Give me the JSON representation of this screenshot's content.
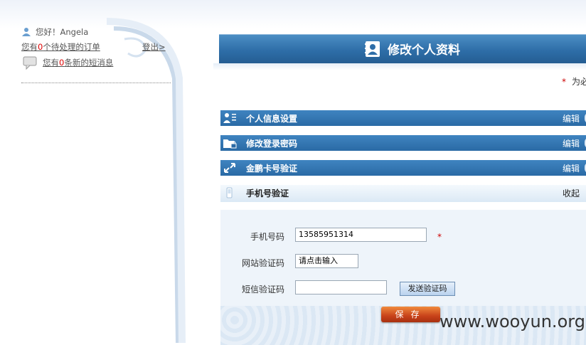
{
  "sidebar": {
    "greeting": "您好！Angela",
    "orders_prefix": "您有",
    "orders_count": "0",
    "orders_suffix": "个待处理的订单",
    "logout": "登出>",
    "msgs_prefix": "您有",
    "msgs_count": "0",
    "msgs_suffix": "条新的短消息"
  },
  "header": {
    "title": "修改个人资料",
    "required_note": "为必"
  },
  "sections": [
    {
      "label": "个人信息设置",
      "action": "编辑",
      "icon": "user-list-icon"
    },
    {
      "label": "修改登录密码",
      "action": "编辑",
      "icon": "folder-lock-icon"
    },
    {
      "label": "金鹏卡号验证",
      "action": "编辑",
      "icon": "arrows-icon"
    },
    {
      "label": "手机号验证",
      "action": "收起",
      "icon": "phone-icon"
    }
  ],
  "form": {
    "phone_label": "手机号码",
    "phone_value": "13585951314",
    "captcha_label": "网站验证码",
    "captcha_value": "请点击输入",
    "sms_label": "短信验证码",
    "sms_value": "",
    "send_code": "发送验证码",
    "save": "保存"
  },
  "watermark": "www.wooyun.org",
  "colors": {
    "header_blue": "#2e6ea8",
    "required_red": "#cc0000",
    "save_orange": "#c8421a"
  }
}
